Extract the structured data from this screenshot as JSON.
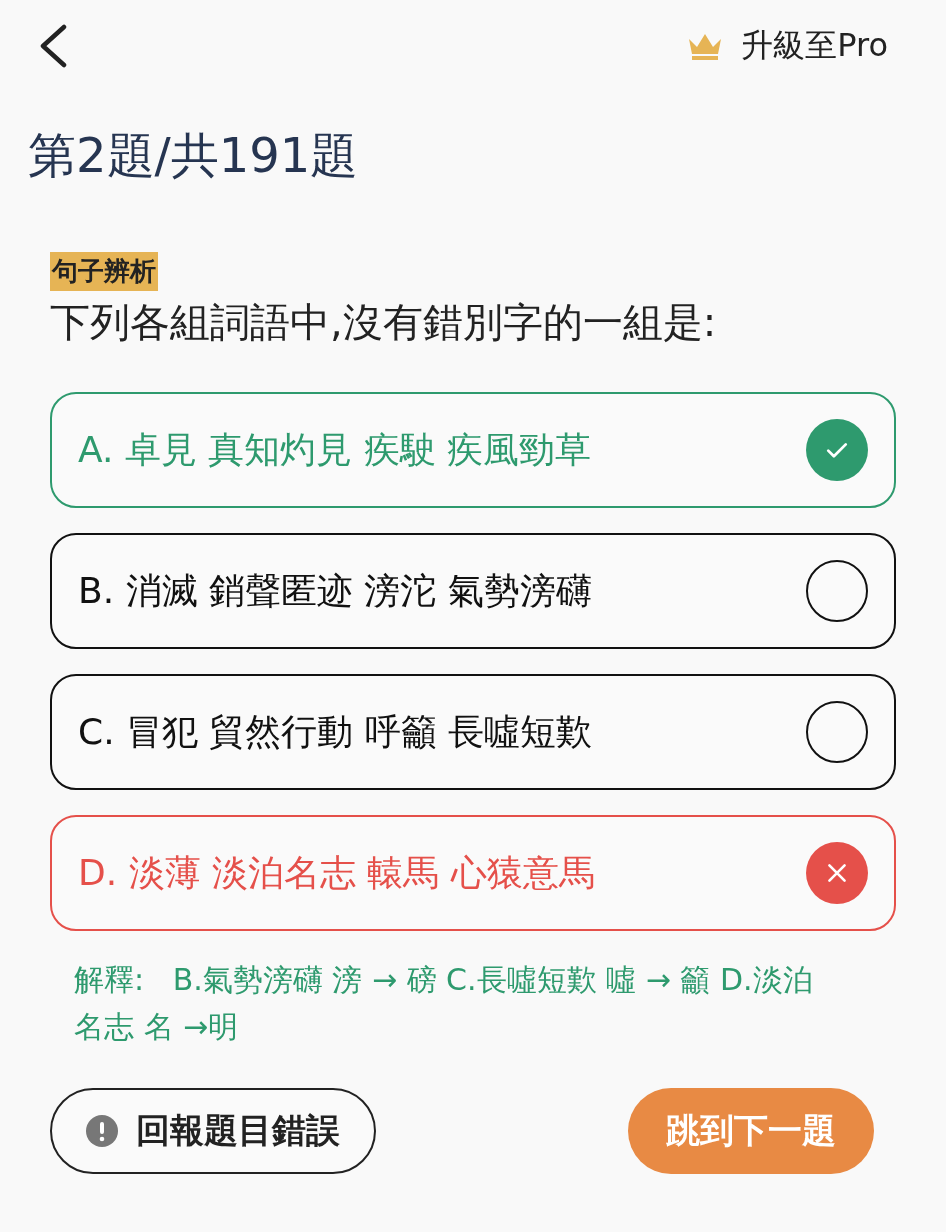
{
  "header": {
    "upgrade_label": "升級至Pro"
  },
  "progress": "第2題/共191題",
  "question": {
    "tag": "句子辨析",
    "text": "下列各組詞語中,沒有錯別字的一組是:"
  },
  "options": [
    {
      "text": "A. 卓見 真知灼見 疾駛 疾風勁草",
      "kind": "correct"
    },
    {
      "text": "B. 消滅 銷聲匿迹 滂沱 氣勢滂礴",
      "kind": "unanswered"
    },
    {
      "text": "C. 冒犯 貿然行動 呼籲 長噓短歎",
      "kind": "unanswered"
    },
    {
      "text": "D. 淡薄 淡泊名志 轅馬 心猿意馬",
      "kind": "wrong"
    }
  ],
  "explanation": "解釋:   B.氣勢滂礴 滂 → 磅 C.長噓短歎 噓 → 籲 D.淡泊名志 名 →明",
  "buttons": {
    "report": "回報題目錯誤",
    "next": "跳到下一題"
  }
}
